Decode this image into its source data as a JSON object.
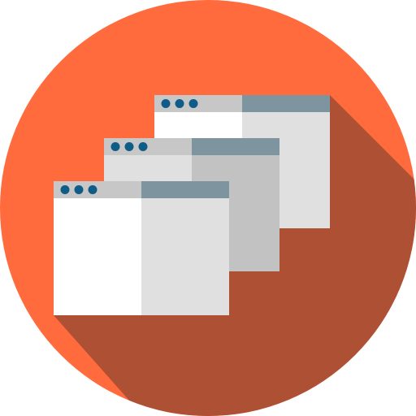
{
  "icon": {
    "name": "multiple-browser-windows-icon",
    "style": "flat-circle-long-shadow"
  },
  "colors": {
    "circle": "#FF6B3D",
    "shadow": "#AE5034",
    "titlebar_left": "#C7C7C7",
    "titlebar_right": "#7E949E",
    "window_left": "#FFFFFF",
    "window_right": "#E0E0E0",
    "window_right_mid": "#C2C2C2",
    "window_left_mid": "#E0E0E0",
    "dots": "#0F5C87"
  },
  "windows": [
    {
      "id": "back",
      "dot_count": 3
    },
    {
      "id": "middle",
      "dot_count": 3
    },
    {
      "id": "front",
      "dot_count": 3
    }
  ]
}
